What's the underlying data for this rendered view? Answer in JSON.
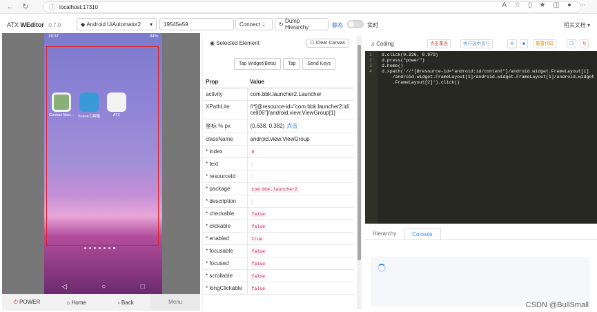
{
  "browser": {
    "url": "localhost:17310"
  },
  "header": {
    "brand": "ATX",
    "brand_name": "WEditor",
    "version": "0.7.0",
    "platform": "Android UiAutomator2",
    "serial": "19545e59",
    "connect": "Connect",
    "dump": "Dump Hierarchy",
    "static_label": "静态",
    "live_label": "实时",
    "docs": "相关文档"
  },
  "phone": {
    "time": "19:37",
    "battery": "84%"
  },
  "apps": [
    {
      "label": "Contact Man..."
    },
    {
      "label": "Scene工具箱"
    },
    {
      "label": "ATX"
    }
  ],
  "device_buttons": [
    "POWER",
    "Home",
    "Back",
    "Menu"
  ],
  "element_panel": {
    "title": "Selected Element",
    "clear_canvas": "Clear Canvas",
    "actions": [
      "Tap Widget(Beta)",
      "Tap",
      "Send Keys"
    ],
    "headers": [
      "Prop",
      "Value"
    ],
    "rows": [
      {
        "k": "activity",
        "v": "com.bbk.launcher2.Launcher",
        "type": "text"
      },
      {
        "k": "XPathLite",
        "v": "//*[@resource-id=\"com.bbk.launcher2:id/cell06\"]/android.view.ViewGroup[1]",
        "type": "text"
      },
      {
        "k": "坐标 % px",
        "v": "(0.638, 0.382)",
        "extra": "点击",
        "type": "coord"
      },
      {
        "k": "className",
        "v": "android.view.ViewGroup",
        "type": "text"
      },
      {
        "k": "* index",
        "v": "0",
        "type": "code"
      },
      {
        "k": "* text",
        "v": "",
        "type": "code"
      },
      {
        "k": "* resourceId",
        "v": "",
        "type": "code"
      },
      {
        "k": "* package",
        "v": "com.bbk.launcher2",
        "type": "code"
      },
      {
        "k": "* description",
        "v": "",
        "type": "code"
      },
      {
        "k": "* checkable",
        "v": "false",
        "type": "code"
      },
      {
        "k": "* clickable",
        "v": "false",
        "type": "code"
      },
      {
        "k": "* enabled",
        "v": "true",
        "type": "code"
      },
      {
        "k": "* focusable",
        "v": "false",
        "type": "code"
      },
      {
        "k": "* focused",
        "v": "false",
        "type": "code"
      },
      {
        "k": "* scrollable",
        "v": "false",
        "type": "code"
      },
      {
        "k": "* longClickable",
        "v": "false",
        "type": "code"
      }
    ]
  },
  "coding": {
    "title": "Coding",
    "stop_btn": "点击重连",
    "run_selected": "执行选中运行",
    "reset_code": "重置代码",
    "lines": [
      "d.click(0.236, 0.973)",
      "d.press(\"power\")",
      "d.home()",
      "d.xpath('//*[@resource-id=\"android:id/content\"]/android.widget.FrameLayout[1]",
      "    /android.widget.FrameLayout[1]/android.widget.FrameLayout[1]/android.widget",
      "    .FrameLayout[2]').click()"
    ],
    "tabs": [
      "Hierarchy",
      "Console"
    ]
  },
  "watermark": "CSDN @BullSmall"
}
